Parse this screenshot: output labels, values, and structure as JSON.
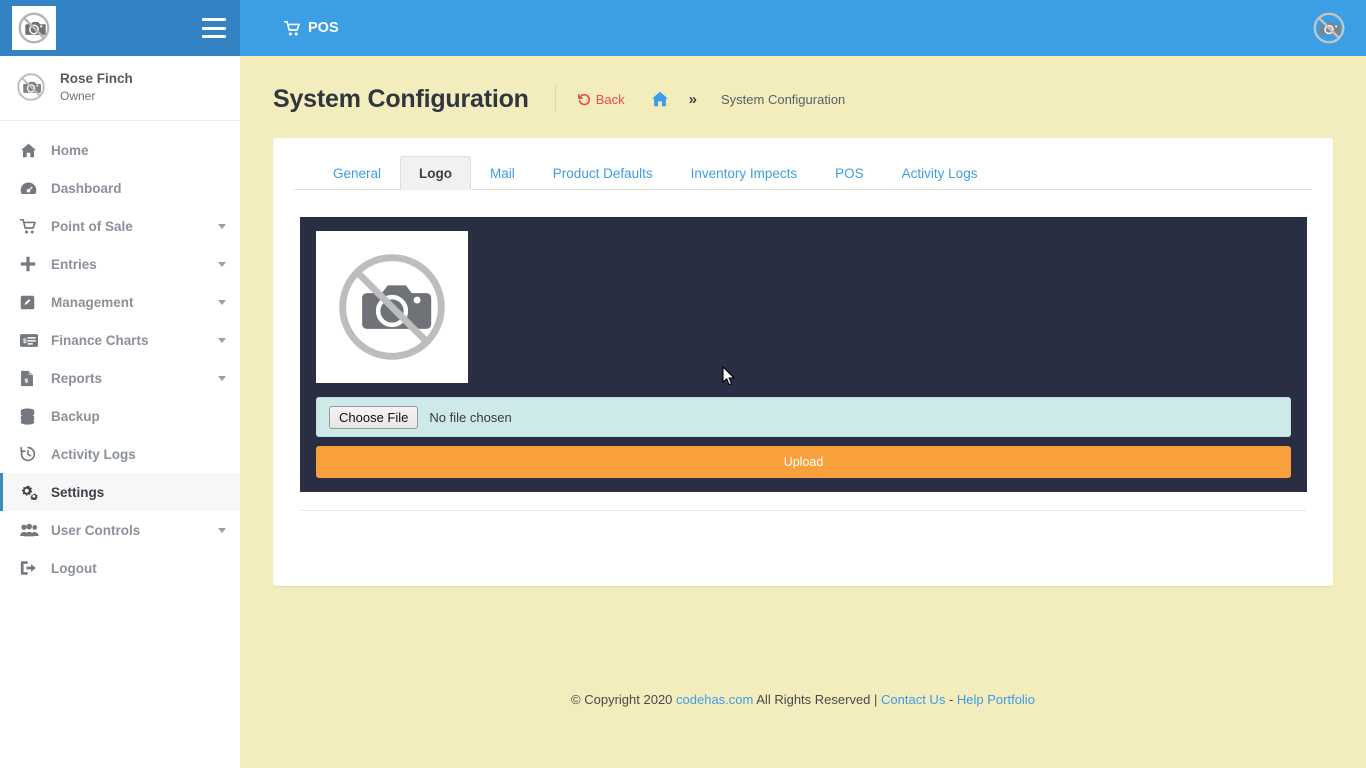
{
  "brand": {
    "logo_icon": "broken-image-icon",
    "sidebar_header_color": "#3382c4",
    "navbar_color": "#3c9ee5",
    "accent_color": "#3c9ee5",
    "content_bg_color": "#f3ecbd",
    "upload_panel_color": "#2a2e43",
    "upload_button_color": "#f9a03c",
    "file_input_color": "#cdeae8"
  },
  "navbar": {
    "menu_toggle_icon": "hamburger-icon",
    "pos_label": "POS",
    "pos_icon": "shopping-cart-icon",
    "user_avatar_icon": "broken-image-icon"
  },
  "sidebar": {
    "user": {
      "name": "Rose Finch",
      "role": "Owner",
      "avatar_icon": "broken-image-icon"
    },
    "items": [
      {
        "label": "Home",
        "icon": "home-icon",
        "caret": false,
        "active": false
      },
      {
        "label": "Dashboard",
        "icon": "dashboard-icon",
        "caret": false,
        "active": false
      },
      {
        "label": "Point of Sale",
        "icon": "shopping-cart-icon",
        "caret": true,
        "active": false
      },
      {
        "label": "Entries",
        "icon": "plus-icon",
        "caret": true,
        "active": false
      },
      {
        "label": "Management",
        "icon": "edit-icon",
        "caret": true,
        "active": false
      },
      {
        "label": "Finance Charts",
        "icon": "money-check-icon",
        "caret": true,
        "active": false
      },
      {
        "label": "Reports",
        "icon": "file-invoice-icon",
        "caret": true,
        "active": false
      },
      {
        "label": "Backup",
        "icon": "database-icon",
        "caret": false,
        "active": false
      },
      {
        "label": "Activity Logs",
        "icon": "history-icon",
        "caret": false,
        "active": false
      },
      {
        "label": "Settings",
        "icon": "gears-icon",
        "caret": false,
        "active": true
      },
      {
        "label": "User Controls",
        "icon": "users-icon",
        "caret": true,
        "active": false
      },
      {
        "label": "Logout",
        "icon": "sign-out-icon",
        "caret": false,
        "active": false
      }
    ]
  },
  "page": {
    "title": "System Configuration",
    "breadcrumb": {
      "back_label": "Back",
      "back_icon": "undo-icon",
      "home_icon": "home-icon",
      "separator": "»",
      "current": "System Configuration"
    }
  },
  "tabs": [
    {
      "label": "General",
      "active": false
    },
    {
      "label": "Logo",
      "active": true
    },
    {
      "label": "Mail",
      "active": false
    },
    {
      "label": "Product Defaults",
      "active": false
    },
    {
      "label": "Inventory Impects",
      "active": false
    },
    {
      "label": "POS",
      "active": false
    },
    {
      "label": "Activity Logs",
      "active": false
    }
  ],
  "logo_tab": {
    "preview_icon": "broken-image-icon",
    "choose_file_label": "Choose File",
    "no_file_label": "No file chosen",
    "upload_label": "Upload"
  },
  "footer": {
    "copyright_prefix": "© Copyright 2020 ",
    "site_link": "codehas.com",
    "rights_text": " All Rights Reserved | ",
    "contact_link": "Contact Us",
    "dash": " - ",
    "help_link": "Help Portfolio"
  }
}
